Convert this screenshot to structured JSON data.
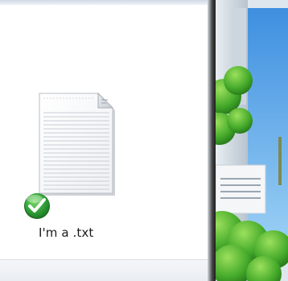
{
  "desktop": {
    "file": {
      "name": "I'm a .txt",
      "icon": "text-file-icon",
      "overlay_icon": "green-checkmark-icon",
      "status_color": "#2fa43a"
    }
  }
}
